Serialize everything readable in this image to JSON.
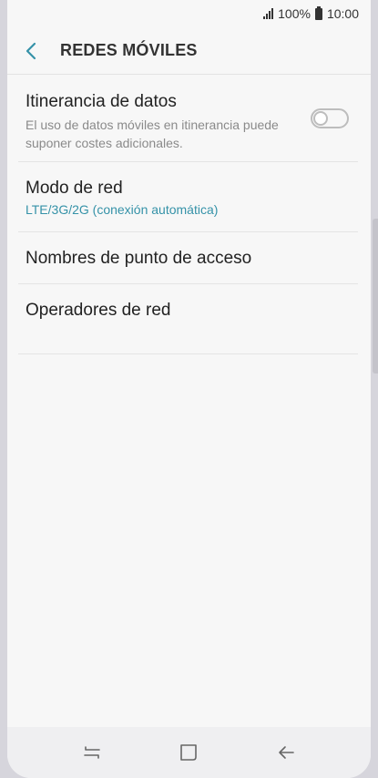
{
  "status_bar": {
    "battery": "100%",
    "time": "10:00"
  },
  "app_bar": {
    "title": "REDES MÓVILES",
    "back_icon": "chevron-left-icon"
  },
  "items": [
    {
      "title": "Itinerancia de datos",
      "subtitle": "El uso de datos móviles en itinerancia puede suponer costes adicionales.",
      "toggle_on": false
    },
    {
      "title": "Modo de red",
      "subtitle": "LTE/3G/2G (conexión automática)"
    },
    {
      "title": "Nombres de punto de acceso"
    },
    {
      "title": "Operadores de red"
    }
  ],
  "colors": {
    "accent": "#3592a8",
    "background": "#f7f7f7"
  },
  "nav": {
    "recents_icon": "recents-icon",
    "home_icon": "home-icon",
    "back_icon": "back-arrow-icon"
  }
}
